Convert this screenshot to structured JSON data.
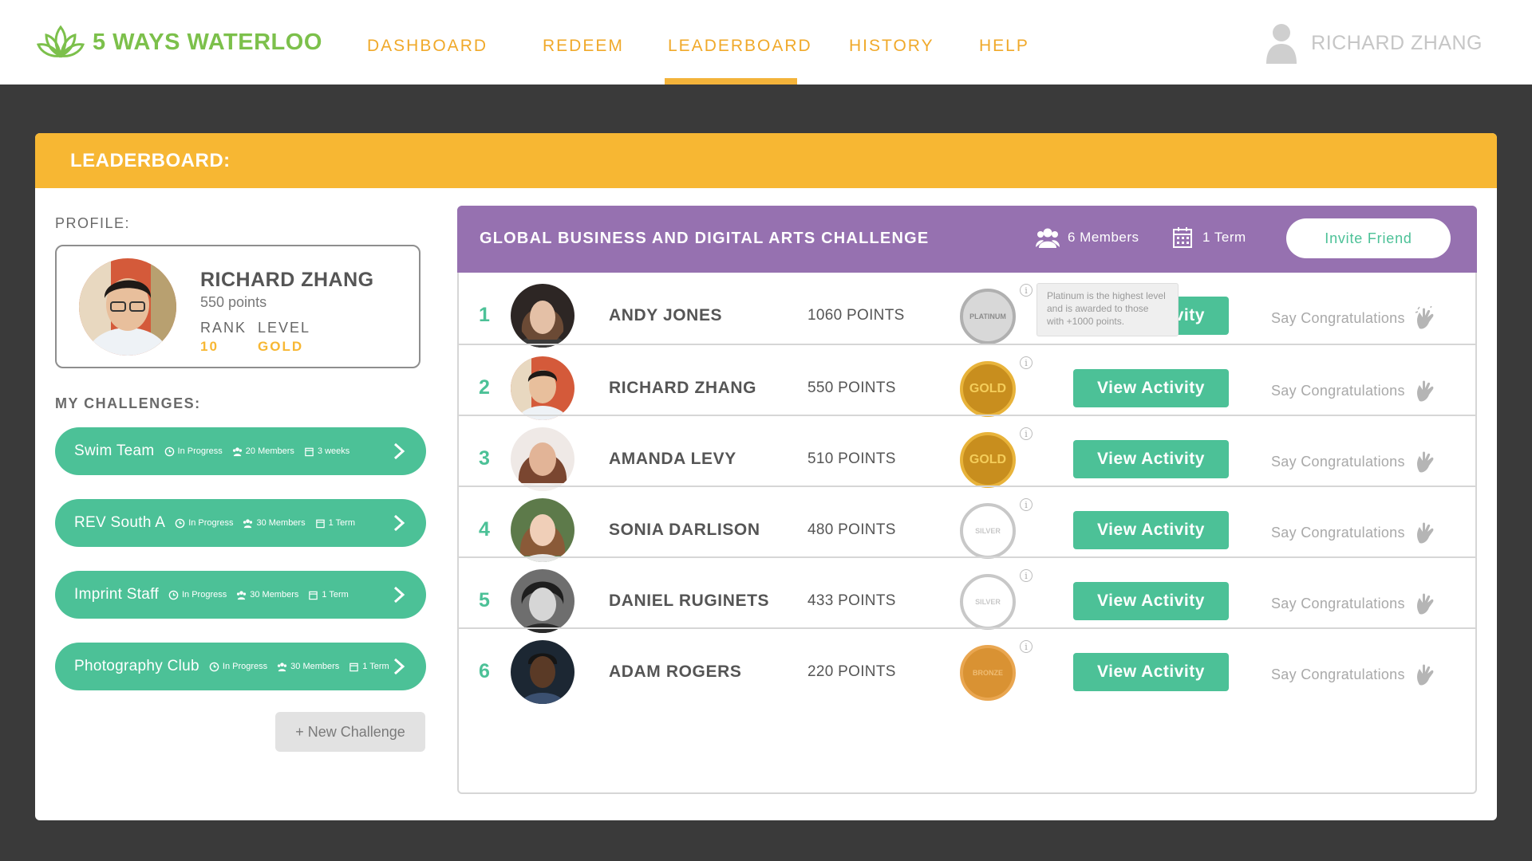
{
  "app": {
    "logo_text": "5 WAYS WATERLOO",
    "nav": [
      "DASHBOARD",
      "REDEEM",
      "LEADERBOARD",
      "HISTORY",
      "HELP"
    ],
    "active_nav": "LEADERBOARD",
    "user_name": "RICHARD ZHANG"
  },
  "colors": {
    "brand_green": "#7cc04b",
    "accent_yellow": "#f7b733",
    "primary_teal": "#4cc197",
    "purple": "#9671b0"
  },
  "page": {
    "title": "LEADERBOARD:"
  },
  "profile": {
    "section_label": "PROFILE:",
    "name": "RICHARD ZHANG",
    "points": "550 points",
    "rank_label": "RANK",
    "rank_value": "10",
    "level_label": "LEVEL",
    "level_value": "GOLD"
  },
  "challenges": {
    "section_label": "MY CHALLENGES:",
    "items": [
      {
        "name": "Swim Team",
        "status": "In Progress",
        "members": "20 Members",
        "duration": "3 weeks"
      },
      {
        "name": "REV South A",
        "status": "In Progress",
        "members": "30 Members",
        "duration": "1 Term"
      },
      {
        "name": "Imprint Staff",
        "status": "In Progress",
        "members": "30 Members",
        "duration": "1 Term"
      },
      {
        "name": "Photography Club",
        "status": "In Progress",
        "members": "30 Members",
        "duration": "1 Term"
      }
    ],
    "new_button": "+ New Challenge"
  },
  "leaderboard": {
    "title": "GLOBAL BUSINESS AND DIGITAL ARTS CHALLENGE",
    "members": "6 Members",
    "duration": "1 Term",
    "invite_button": "Invite Friend",
    "view_button": "View Activity",
    "congrats_label": "Say Congratulations",
    "tooltip": "Platinum is the highest level and is awarded to those with +1000 points.",
    "rows": [
      {
        "rank": "1",
        "name": "ANDY JONES",
        "points": "1060 POINTS",
        "level": "PLATINUM"
      },
      {
        "rank": "2",
        "name": "RICHARD ZHANG",
        "points": "550 POINTS",
        "level": "GOLD"
      },
      {
        "rank": "3",
        "name": "AMANDA LEVY",
        "points": "510 POINTS",
        "level": "GOLD"
      },
      {
        "rank": "4",
        "name": "SONIA DARLISON",
        "points": "480 POINTS",
        "level": "SILVER"
      },
      {
        "rank": "5",
        "name": "DANIEL RUGINETS",
        "points": "433 POINTS",
        "level": "SILVER"
      },
      {
        "rank": "6",
        "name": "ADAM ROGERS",
        "points": "220 POINTS",
        "level": "BRONZE"
      }
    ]
  }
}
